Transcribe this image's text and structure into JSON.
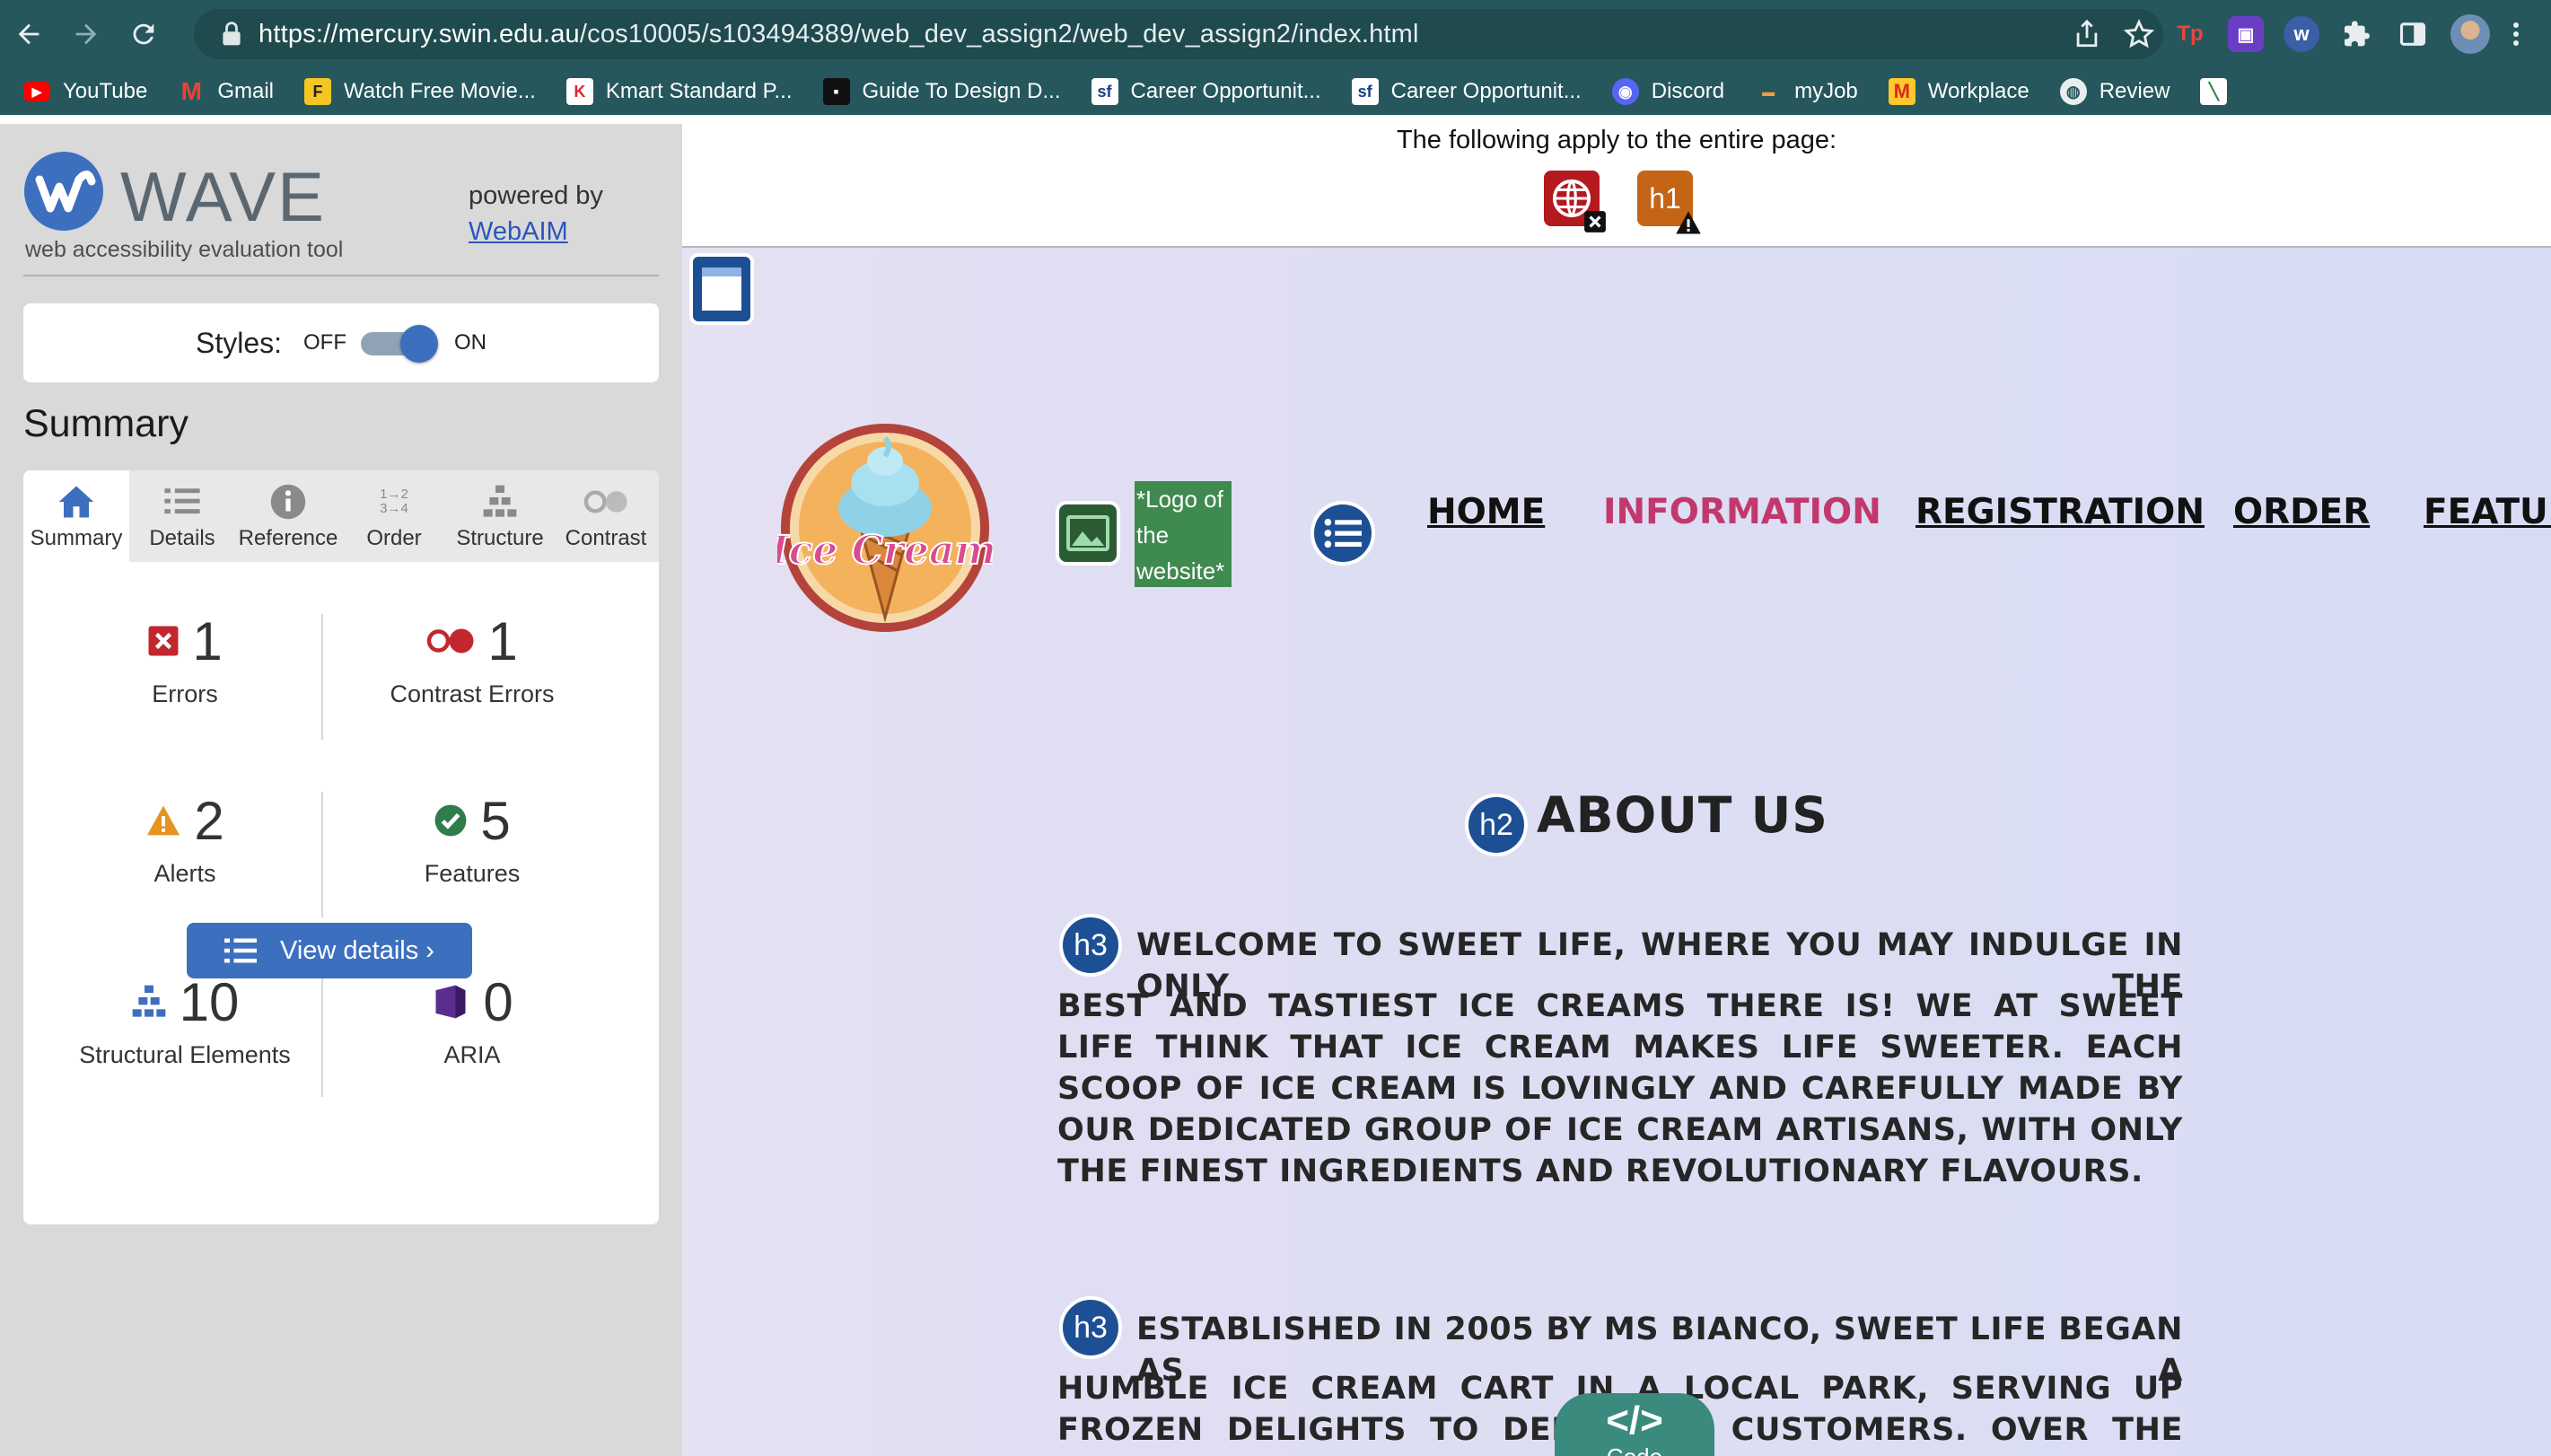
{
  "browser": {
    "url_host": "https://mercury.swin.edu.au",
    "url_path": "/cos10005/s103494389/web_dev_assign2/web_dev_assign2/index.html",
    "bookmarks": [
      "YouTube",
      "Gmail",
      "Watch Free Movie...",
      "Kmart Standard P...",
      "Guide To Design D...",
      "Career Opportunit...",
      "Career Opportunit...",
      "Discord",
      "myJob",
      "Workplace",
      "Review"
    ]
  },
  "wave": {
    "title": "WAVE",
    "subtitle": "web accessibility evaluation tool",
    "powered_by": "powered by",
    "webaim": "WebAIM",
    "styles_label": "Styles:",
    "off": "OFF",
    "on": "ON",
    "summary_heading": "Summary",
    "tabs": [
      "Summary",
      "Details",
      "Reference",
      "Order",
      "Structure",
      "Contrast"
    ],
    "stats": [
      {
        "num": "1",
        "label": "Errors"
      },
      {
        "num": "1",
        "label": "Contrast Errors"
      },
      {
        "num": "2",
        "label": "Alerts"
      },
      {
        "num": "5",
        "label": "Features"
      },
      {
        "num": "10",
        "label": "Structural Elements"
      },
      {
        "num": "0",
        "label": "ARIA"
      }
    ],
    "view_details": "View details ›",
    "order_icon_text": "1→2 3→4"
  },
  "page": {
    "apply_text": "The following apply to the entire page:",
    "h1_icon": "h1",
    "logo_alt": "*Logo of the website*",
    "logo_text": "Ice Cream",
    "nav": [
      "HOME",
      "INFORMATION",
      "REGISTRATION",
      "ORDER",
      "FEATUR"
    ],
    "h2_icon": "h2",
    "h3_icon": "h3",
    "about_heading": "ABOUT US",
    "para1_first": "WELCOME TO SWEET LIFE, WHERE YOU MAY INDULGE IN ONLY THE",
    "para1_rest": "BEST AND TASTIEST ICE CREAMS THERE IS! WE AT SWEET LIFE THINK THAT ICE CREAM MAKES LIFE SWEETER. EACH SCOOP OF ICE CREAM IS LOVINGLY AND CAREFULLY MADE BY OUR DEDICATED GROUP OF ICE CREAM ARTISANS, WITH ONLY THE FINEST INGREDIENTS AND REVOLUTIONARY FLAVOURS.",
    "para2_first": "ESTABLISHED IN 2005 BY MS BIANCO, SWEET LIFE BEGAN AS A",
    "para2_rest": "HUMBLE ICE CREAM CART IN A LOCAL PARK, SERVING UP FROZEN DELIGHTS TO DELIGHTED CUSTOMERS. OVER THE YEARS, OUR PASSION",
    "code_tab_symbol": "</>",
    "code_tab_label": "Code"
  }
}
